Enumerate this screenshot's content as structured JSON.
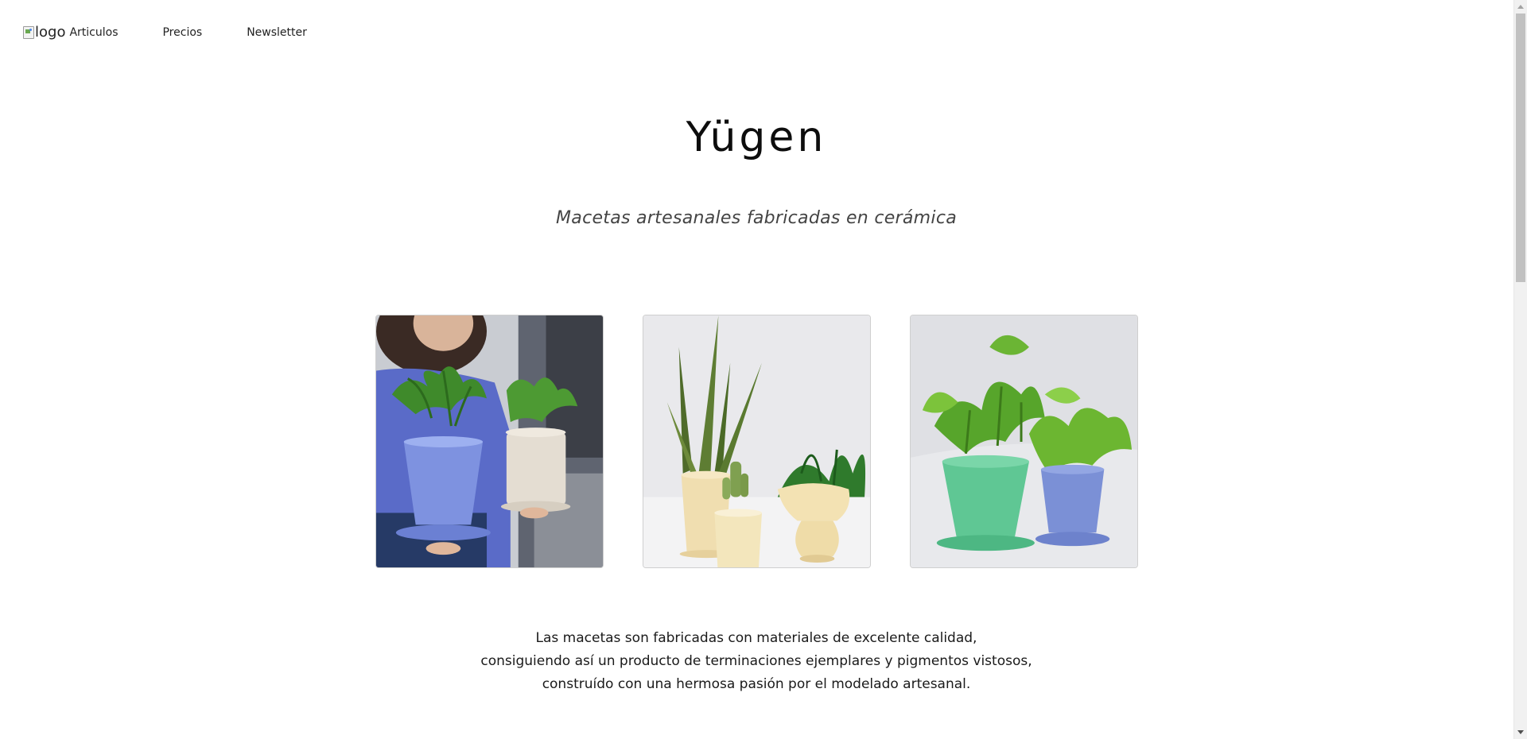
{
  "nav": {
    "logo_alt": "logo",
    "items": [
      {
        "label": "Articulos"
      },
      {
        "label": "Precios"
      },
      {
        "label": "Newsletter"
      }
    ]
  },
  "hero": {
    "title": "Yügen",
    "subtitle": "Macetas artesanales fabricadas en cerámica"
  },
  "gallery": {
    "images": [
      {
        "name": "woman-holding-two-potted-plants"
      },
      {
        "name": "snake-plant-cactus-peace-lily-cream-pots"
      },
      {
        "name": "pothos-in-green-and-blue-pots"
      }
    ]
  },
  "description": {
    "lines": [
      "Las macetas son fabricadas con materiales de excelente calidad,",
      "consiguiendo así un producto de terminaciones ejemplares y pigmentos vistosos,",
      "construído con una hermosa pasión por el modelado artesanal."
    ]
  },
  "colors": {
    "background": "#ffffff",
    "text": "#111111",
    "subtitle": "#444444"
  }
}
